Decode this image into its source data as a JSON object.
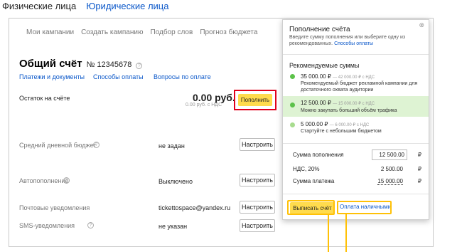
{
  "top_tabs": {
    "individuals": "Физические лица",
    "legal": "Юридические лица"
  },
  "nav": [
    "Мои кампании",
    "Создать кампанию",
    "Подбор слов",
    "Прогноз бюджета"
  ],
  "account": {
    "title": "Общий счёт",
    "number": "№ 12345678",
    "links": [
      "Платежи и документы",
      "Способы оплаты",
      "Вопросы по оплате"
    ],
    "balance_label": "Остаток на счёте",
    "balance_amount": "0.00 руб.",
    "balance_vat": "0.00 руб. с НДС",
    "topup_label": "Пополнить"
  },
  "settings_rows": [
    {
      "label": "Средний дневной бюджет",
      "value": "не задан",
      "button": "Настроить"
    },
    {
      "label": "Автопополнение",
      "value": "Выключено",
      "button": "Настроить"
    },
    {
      "label": "Почтовые уведомления",
      "value": "tickettospace@yandex.ru",
      "button": "Настроить"
    },
    {
      "label": "SMS-уведомления",
      "value": "не указан",
      "button": "Настроить"
    }
  ],
  "popup": {
    "title": "Пополнение счёта",
    "close": "⊗",
    "desc": "Введите сумму пополнения или выберите одну из рекомендованных.",
    "desc_link": "Способы оплаты",
    "rec_title": "Рекомендуемые суммы",
    "options": [
      {
        "amount": "35 000.00 ₽",
        "old": "— 42 000.00 ₽ с НДС",
        "desc": "Рекомендуемый бюджет рекламной кампании для достаточного охвата аудитории",
        "dot_color": "#5cc24a"
      },
      {
        "amount": "12 500.00 ₽",
        "old": "— 15 000.00 ₽ с НДС",
        "desc": "Можно закупать больший объём трафика",
        "dot_color": "#5cc24a"
      },
      {
        "amount": "5 000.00 ₽",
        "old": "— 6 000.00 ₽ с НДС",
        "desc": "Стартуйте с небольшим бюджетом",
        "dot_color": "#a8dc8f"
      }
    ],
    "calc": {
      "sum_label": "Сумма пополнения",
      "sum_value": "12 500.00",
      "vat_label": "НДС, 20%",
      "vat_value": "2 500.00",
      "total_label": "Сумма платежа",
      "total_value": "15 000.00",
      "currency": "₽"
    },
    "invoice_button": "Выписать счёт",
    "cash_link": "Оплата наличными"
  },
  "colors": {
    "accent_yellow": "#ffdb4d",
    "link_blue": "#0a57c9",
    "highlight_red": "#e0001b",
    "selected_green": "#def3d3",
    "annotation_yellow": "#ffc107"
  }
}
